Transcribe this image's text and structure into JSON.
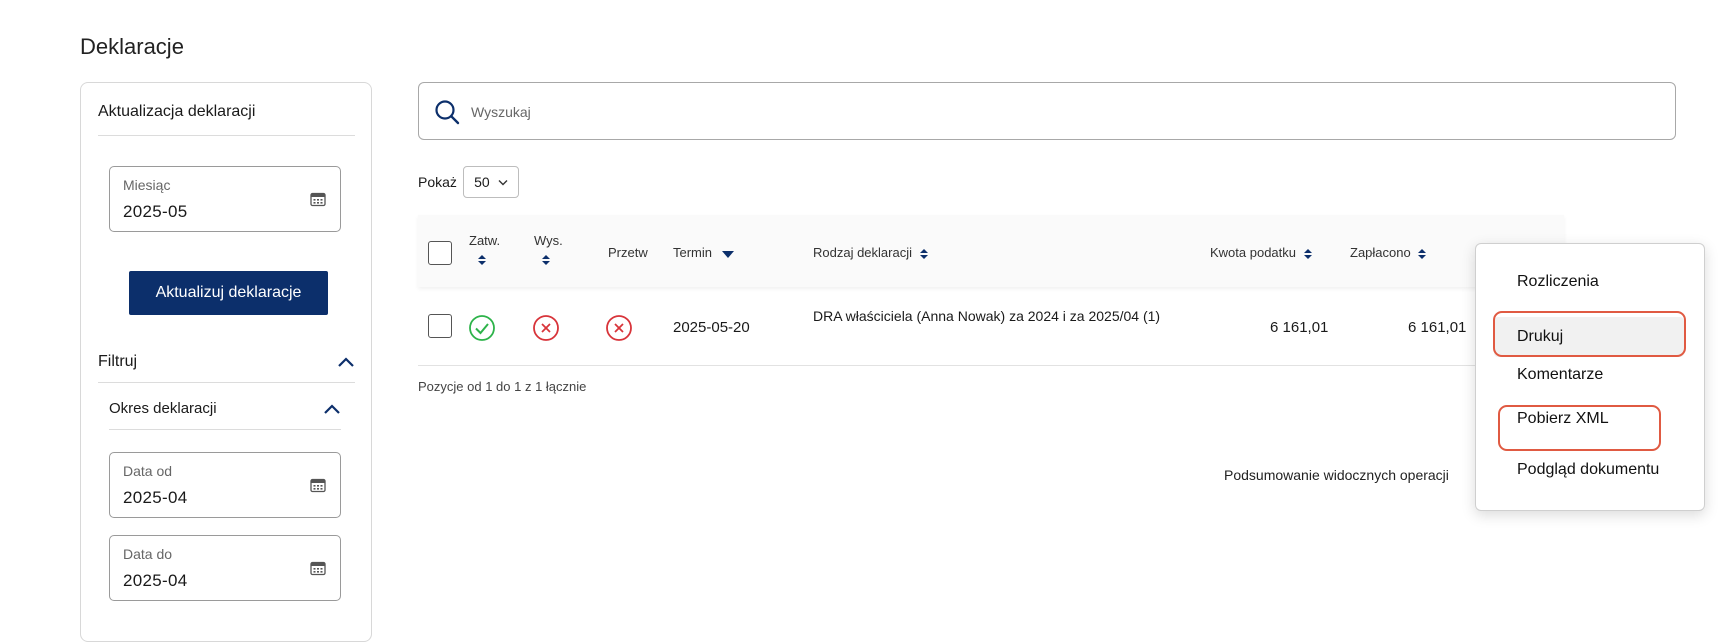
{
  "page": {
    "title": "Deklaracje"
  },
  "sidebar": {
    "header": "Aktualizacja deklaracji",
    "month_field": {
      "label": "Miesiąc",
      "value": "2025-05",
      "icon": "calendar-icon"
    },
    "update_button": "Aktualizuj deklaracje",
    "filter_section": "Filtruj",
    "period_section": "Okres deklaracji",
    "date_from": {
      "label": "Data od",
      "value": "2025-04",
      "icon": "calendar-icon"
    },
    "date_to": {
      "label": "Data do",
      "value": "2025-04",
      "icon": "calendar-icon"
    }
  },
  "search": {
    "placeholder": "Wyszukaj",
    "icon": "search-icon"
  },
  "page_size": {
    "label": "Pokaż",
    "value": "50"
  },
  "table": {
    "columns": {
      "approved": "Zatw.",
      "sent": "Wys.",
      "processed": "Przetw",
      "due": "Termin",
      "type": "Rodzaj deklaracji",
      "tax_amount": "Kwota podatku",
      "paid": "Zapłacono"
    },
    "rows": [
      {
        "approved": "ok",
        "sent": "error",
        "processed": "error",
        "due": "2025-05-20",
        "type": "DRA właściciela (Anna Nowak) za 2024 i za 2025/04 (1)",
        "tax_amount": "6 161,01",
        "paid": "6 161,01"
      }
    ],
    "info": "Pozycje od 1 do 1 z 1 łącznie",
    "summary": "Podsumowanie widocznych operacji"
  },
  "context_menu": {
    "items": [
      "Rozliczenia",
      "Drukuj",
      "Komentarze",
      "Pobierz XML",
      "Podgląd dokumentu"
    ],
    "highlighted": [
      "Drukuj",
      "Pobierz XML"
    ]
  },
  "colors": {
    "primary": "#0c2f6b",
    "success": "#2db34a",
    "error": "#d8343a",
    "highlight": "#e05a42"
  }
}
